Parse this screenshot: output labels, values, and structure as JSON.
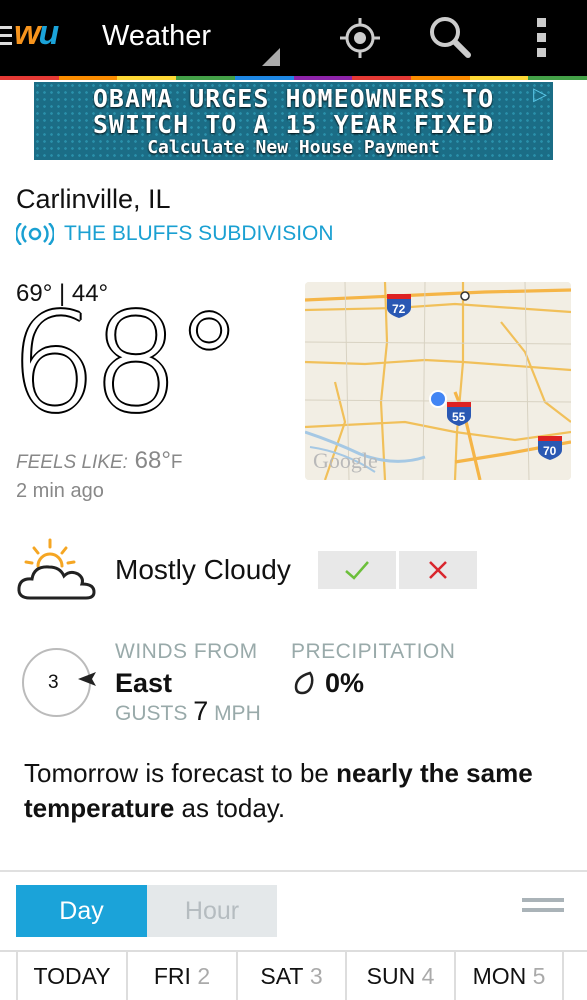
{
  "app": {
    "logo": "wu",
    "title": "Weather",
    "actions": [
      "location-icon",
      "search-icon",
      "overflow-menu-icon"
    ],
    "stripe_colors": [
      "#e53935",
      "#fb8c00",
      "#fdd835",
      "#43a047",
      "#1e88e5",
      "#8e24aa",
      "#e53935",
      "#fb8c00",
      "#fdd835",
      "#43a047"
    ]
  },
  "ad": {
    "line1": "OBAMA URGES HOMEOWNERS TO",
    "line2": "SWITCH TO A 15 YEAR FIXED",
    "line3": "Calculate New House Payment"
  },
  "location": {
    "city": "Carlinville, IL",
    "station": "THE BLUFFS SUBDIVISION"
  },
  "current": {
    "hilo": "69° | 44°",
    "temp": "68°",
    "feels_label": "FEELS LIKE:",
    "feels_value": "68°",
    "feels_unit": "F",
    "updated": "2 min ago",
    "condition": "Mostly Cloudy"
  },
  "map": {
    "shields": [
      "72",
      "55",
      "70"
    ],
    "watermark": "Google"
  },
  "wind": {
    "speed": "3",
    "from_label": "WINDS FROM",
    "direction": "East",
    "gusts_label": "GUSTS",
    "gusts_value": "7",
    "gusts_unit": "MPH"
  },
  "precip": {
    "label": "PRECIPITATION",
    "value": "0%"
  },
  "forecast": {
    "prefix": "Tomorrow is forecast to be ",
    "bold": "nearly the same temperature",
    "suffix": " as today."
  },
  "toggle": {
    "day": "Day",
    "hour": "Hour"
  },
  "days": [
    {
      "label": "TODAY",
      "num": ""
    },
    {
      "label": "FRI",
      "num": "2"
    },
    {
      "label": "SAT",
      "num": "3"
    },
    {
      "label": "SUN",
      "num": "4"
    },
    {
      "label": "MON",
      "num": "5"
    }
  ]
}
